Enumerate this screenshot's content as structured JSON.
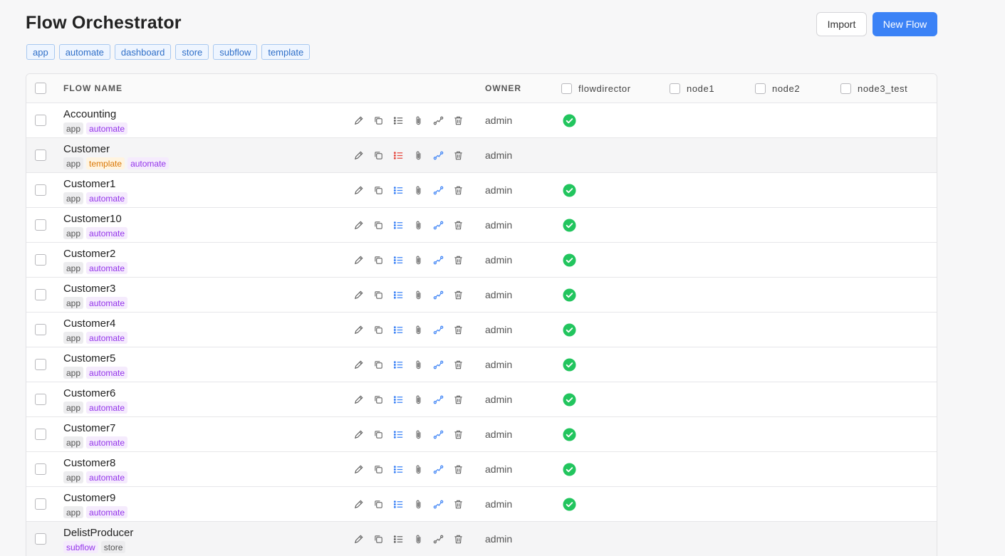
{
  "header": {
    "title": "Flow Orchestrator",
    "import_label": "Import",
    "new_flow_label": "New Flow"
  },
  "filters": [
    "app",
    "automate",
    "dashboard",
    "store",
    "subflow",
    "template"
  ],
  "table": {
    "col_flow_name": "FLOW NAME",
    "col_owner": "OWNER",
    "node_columns": [
      "flowdirector",
      "node1",
      "node2",
      "node3_test"
    ]
  },
  "colors": {
    "primary": "#3b82f6",
    "success": "#22c55e",
    "danger": "#e5483f",
    "tag_purple": "#9333ea",
    "tag_orange": "#d97706"
  },
  "rows": [
    {
      "name": "Accounting",
      "tags": [
        {
          "text": "app",
          "kind": "gray"
        },
        {
          "text": "automate",
          "kind": "purple"
        }
      ],
      "owner": "admin",
      "status_flowdirector": "ok",
      "list_state": "gray",
      "link_state": "gray",
      "highlighted": false
    },
    {
      "name": "Customer",
      "tags": [
        {
          "text": "app",
          "kind": "gray"
        },
        {
          "text": "template",
          "kind": "orange"
        },
        {
          "text": "automate",
          "kind": "purple"
        }
      ],
      "owner": "admin",
      "status_flowdirector": "none",
      "list_state": "red",
      "link_state": "blue",
      "highlighted": true
    },
    {
      "name": "Customer1",
      "tags": [
        {
          "text": "app",
          "kind": "gray"
        },
        {
          "text": "automate",
          "kind": "purple"
        }
      ],
      "owner": "admin",
      "status_flowdirector": "ok",
      "list_state": "blue",
      "link_state": "blue",
      "highlighted": false
    },
    {
      "name": "Customer10",
      "tags": [
        {
          "text": "app",
          "kind": "gray"
        },
        {
          "text": "automate",
          "kind": "purple"
        }
      ],
      "owner": "admin",
      "status_flowdirector": "ok",
      "list_state": "blue",
      "link_state": "blue",
      "highlighted": false
    },
    {
      "name": "Customer2",
      "tags": [
        {
          "text": "app",
          "kind": "gray"
        },
        {
          "text": "automate",
          "kind": "purple"
        }
      ],
      "owner": "admin",
      "status_flowdirector": "ok",
      "list_state": "blue",
      "link_state": "blue",
      "highlighted": false
    },
    {
      "name": "Customer3",
      "tags": [
        {
          "text": "app",
          "kind": "gray"
        },
        {
          "text": "automate",
          "kind": "purple"
        }
      ],
      "owner": "admin",
      "status_flowdirector": "ok",
      "list_state": "blue",
      "link_state": "blue",
      "highlighted": false
    },
    {
      "name": "Customer4",
      "tags": [
        {
          "text": "app",
          "kind": "gray"
        },
        {
          "text": "automate",
          "kind": "purple"
        }
      ],
      "owner": "admin",
      "status_flowdirector": "ok",
      "list_state": "blue",
      "link_state": "blue",
      "highlighted": false
    },
    {
      "name": "Customer5",
      "tags": [
        {
          "text": "app",
          "kind": "gray"
        },
        {
          "text": "automate",
          "kind": "purple"
        }
      ],
      "owner": "admin",
      "status_flowdirector": "ok",
      "list_state": "blue",
      "link_state": "blue",
      "highlighted": false
    },
    {
      "name": "Customer6",
      "tags": [
        {
          "text": "app",
          "kind": "gray"
        },
        {
          "text": "automate",
          "kind": "purple"
        }
      ],
      "owner": "admin",
      "status_flowdirector": "ok",
      "list_state": "blue",
      "link_state": "blue",
      "highlighted": false
    },
    {
      "name": "Customer7",
      "tags": [
        {
          "text": "app",
          "kind": "gray"
        },
        {
          "text": "automate",
          "kind": "purple"
        }
      ],
      "owner": "admin",
      "status_flowdirector": "ok",
      "list_state": "blue",
      "link_state": "blue",
      "highlighted": false
    },
    {
      "name": "Customer8",
      "tags": [
        {
          "text": "app",
          "kind": "gray"
        },
        {
          "text": "automate",
          "kind": "purple"
        }
      ],
      "owner": "admin",
      "status_flowdirector": "ok",
      "list_state": "blue",
      "link_state": "blue",
      "highlighted": false
    },
    {
      "name": "Customer9",
      "tags": [
        {
          "text": "app",
          "kind": "gray"
        },
        {
          "text": "automate",
          "kind": "purple"
        }
      ],
      "owner": "admin",
      "status_flowdirector": "ok",
      "list_state": "blue",
      "link_state": "blue",
      "highlighted": false
    },
    {
      "name": "DelistProducer",
      "tags": [
        {
          "text": "subflow",
          "kind": "purple"
        },
        {
          "text": "store",
          "kind": "gray"
        }
      ],
      "owner": "admin",
      "status_flowdirector": "none",
      "list_state": "gray",
      "link_state": "gray",
      "highlighted": true
    }
  ]
}
